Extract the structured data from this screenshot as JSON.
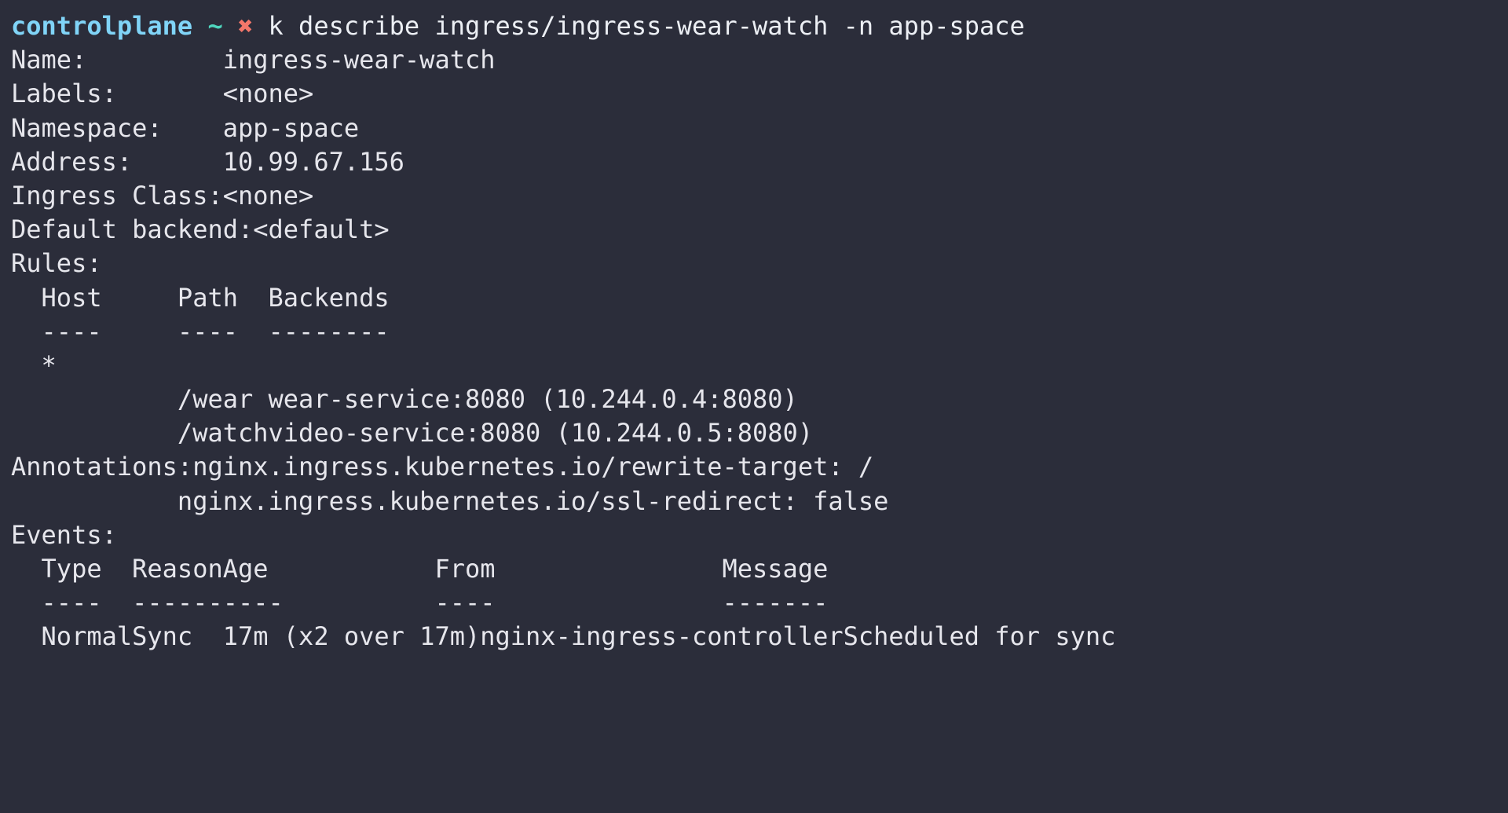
{
  "terminal": {
    "background_color": "#2b2d3a",
    "foreground_color": "#e6e6ec",
    "prompt": {
      "host": "controlplane",
      "path": "~",
      "status_icon": "✖",
      "host_color": "#80d4f7",
      "path_color": "#4fd6be",
      "status_color": "#f4776a"
    },
    "command": "k describe ingress/ingress-wear-watch -n app-space"
  },
  "describe": {
    "fields": [
      {
        "label": "Name:",
        "value": "ingress-wear-watch"
      },
      {
        "label": "Labels:",
        "value": "<none>"
      },
      {
        "label": "Namespace:",
        "value": "app-space"
      },
      {
        "label": "Address:",
        "value": "10.99.67.156"
      },
      {
        "label": "Ingress Class:",
        "value": "<none>"
      },
      {
        "label": "Default backend:",
        "value": "<default>"
      }
    ],
    "rules_label": "Rules:",
    "rules_table": {
      "headers": {
        "host": "Host",
        "path": "Path",
        "backends": "Backends"
      },
      "rules_dashes": {
        "host": "----",
        "path": "----",
        "backends": "--------"
      },
      "host_value": "*",
      "rows": [
        {
          "path": "/wear",
          "backend": "wear-service:8080 (10.244.0.4:8080)"
        },
        {
          "path": "/watch",
          "backend": "video-service:8080 (10.244.0.5:8080)"
        }
      ]
    },
    "annotations_label": "Annotations:",
    "annotations": [
      "nginx.ingress.kubernetes.io/rewrite-target: /",
      "nginx.ingress.kubernetes.io/ssl-redirect: false"
    ],
    "events_label": "Events:",
    "events_table": {
      "headers": {
        "type": "Type",
        "reason": "Reason",
        "age": "Age",
        "from": "From",
        "message": "Message"
      },
      "dashes": {
        "type": "----",
        "reason": "------",
        "age": "----",
        "from": "----",
        "message": "-------"
      },
      "rows": [
        {
          "type": "Normal",
          "reason": "Sync",
          "age": "17m (x2 over 17m)",
          "from": "nginx-ingress-controller",
          "message": "Scheduled for sync"
        }
      ]
    }
  }
}
